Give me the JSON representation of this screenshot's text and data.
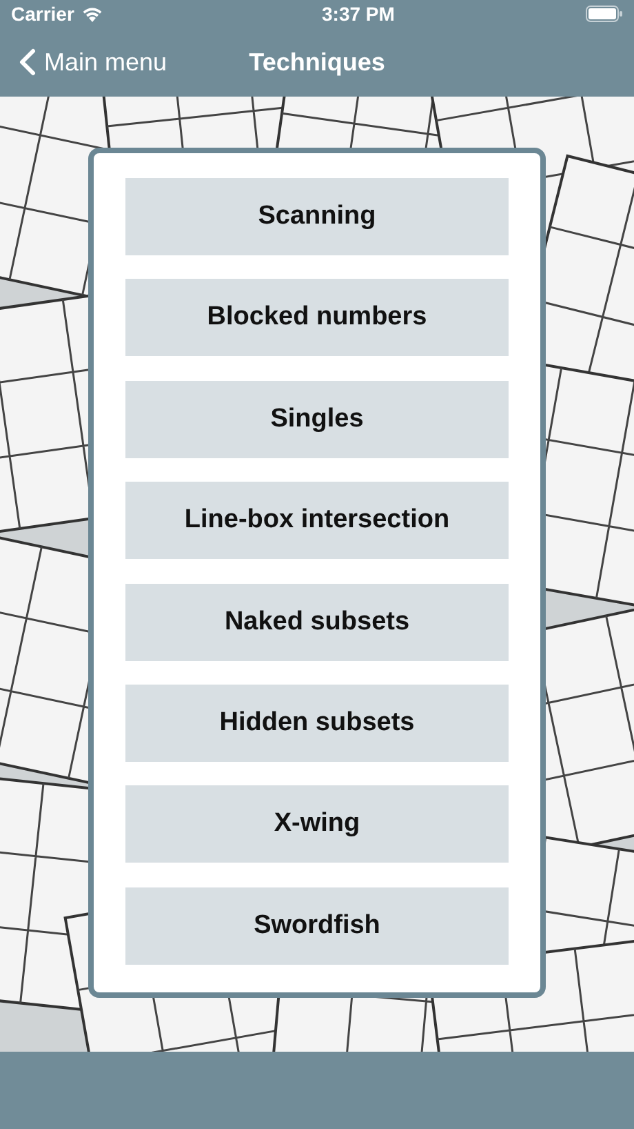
{
  "status_bar": {
    "carrier": "Carrier",
    "time": "3:37 PM"
  },
  "nav_bar": {
    "back_label": "Main menu",
    "title": "Techniques"
  },
  "techniques": [
    {
      "label": "Scanning"
    },
    {
      "label": "Blocked numbers"
    },
    {
      "label": "Singles"
    },
    {
      "label": "Line-box intersection"
    },
    {
      "label": "Naked subsets"
    },
    {
      "label": "Hidden subsets"
    },
    {
      "label": "X-wing"
    },
    {
      "label": "Swordfish"
    }
  ]
}
